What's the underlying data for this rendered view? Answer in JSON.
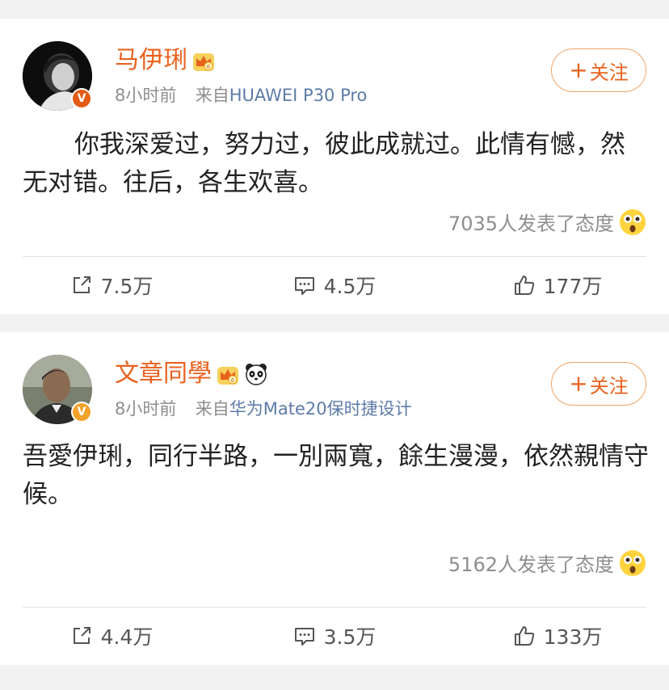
{
  "posts": [
    {
      "author": "马伊琍",
      "time": "8小时前",
      "source_prefix": "来自",
      "device": "HUAWEI P30 Pro",
      "follow_label": "关注",
      "text": "你我深爱过，努力过，彼此成就过。此情有憾，然无对错。往后，各生欢喜。",
      "reactions": "7035人发表了态度",
      "repost_count": "7.5万",
      "comment_count": "4.5万",
      "like_count": "177万",
      "icons": {
        "verified": "orange-verified-v-badge",
        "vip": "crown-icon",
        "reaction": "surprised-face-emoji",
        "repost": "share-icon",
        "comment": "comment-icon",
        "like": "thumbs-up-icon"
      }
    },
    {
      "author": "文章同學",
      "time": "8小时前",
      "source_prefix": "来自",
      "device": "华为Mate20保时捷设计",
      "follow_label": "关注",
      "text": "吾愛伊琍，同行半路，一別兩寬，餘生漫漫，依然親情守候。",
      "reactions": "5162人发表了态度",
      "repost_count": "4.4万",
      "comment_count": "3.5万",
      "like_count": "133万",
      "icons": {
        "verified": "yellow-verified-v-badge",
        "vip": "crown-icon",
        "badge": "panda-icon",
        "reaction": "surprised-face-emoji",
        "repost": "share-icon",
        "comment": "comment-icon",
        "like": "thumbs-up-icon"
      }
    }
  ],
  "colors": {
    "name": "#e8611d",
    "device": "#5d7ba8",
    "muted": "#8e8e8e",
    "follow_border": "#f0a466",
    "background": "#f2f2f2"
  }
}
